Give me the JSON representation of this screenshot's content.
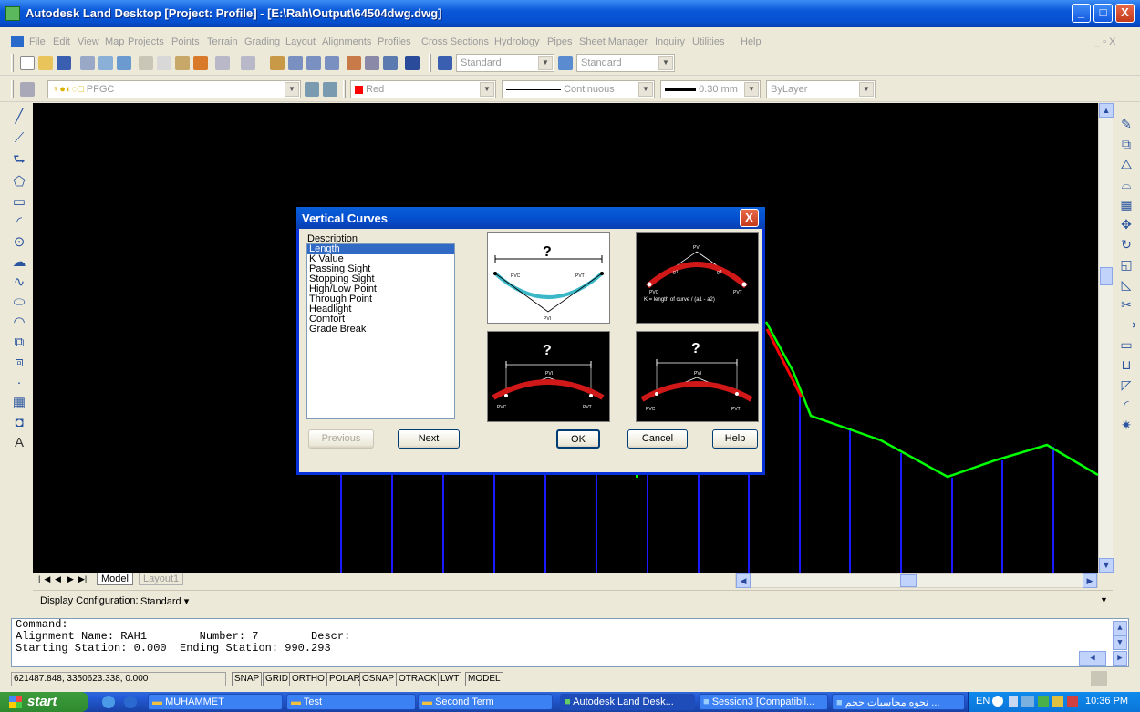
{
  "window": {
    "title": "Autodesk Land Desktop [Project: Profile] - [E:\\Rah\\Output\\64504dwg.dwg]",
    "minimize": "_",
    "maximize": "□",
    "close": "X"
  },
  "menu": {
    "items": [
      "File",
      "Edit",
      "View",
      "Map",
      "Projects",
      "Points",
      "Terrain",
      "Grading",
      "Layout",
      "Alignments",
      "Profiles",
      "Cross Sections",
      "Hydrology",
      "Pipes",
      "Sheet Manager",
      "Inquiry",
      "Utilities",
      "Help"
    ],
    "doc_controls": "_ ▫ X"
  },
  "toolbar1": {
    "text_style": "Standard",
    "dim_style": "Standard"
  },
  "toolbar2": {
    "layer": "PFGC",
    "color": "Red",
    "linetype": "Continuous",
    "lineweight": "0.30 mm",
    "plotstyle": "ByLayer",
    "color_hex": "#ff0000"
  },
  "drawing_tabs": {
    "nav": [
      "|◀",
      "◀",
      "▶",
      "▶|"
    ],
    "model": "Model",
    "layout1": "Layout1"
  },
  "display_configuration": {
    "label": "Display Configuration:",
    "value": "Standard ▾"
  },
  "command": {
    "lines": [
      "Command:",
      "Alignment Name: RAH1        Number: 7        Descr:",
      "Starting Station: 0.000  Ending Station: 990.293"
    ]
  },
  "statusbar": {
    "coords": "621487.848, 3350623.338, 0.000",
    "toggles": [
      "SNAP",
      "GRID",
      "ORTHO",
      "POLAR",
      "OSNAP",
      "OTRACK",
      "LWT",
      "MODEL"
    ]
  },
  "dialog": {
    "title": "Vertical Curves",
    "close": "X",
    "description_label": "Description",
    "items": [
      "Length",
      "K Value",
      "Passing Sight",
      "Stopping Sight",
      "High/Low Point",
      "Through Point",
      "Headlight",
      "Comfort",
      "Grade Break"
    ],
    "selected_index": 0,
    "buttons": {
      "previous": "Previous",
      "next": "Next",
      "ok": "OK",
      "cancel": "Cancel",
      "help": "Help"
    },
    "diagram_question": "?",
    "diagram_formula": "K = length of curve / (a1 - a2)"
  },
  "taskbar": {
    "start": "start",
    "tasks": [
      "MUHAMMET",
      "Test",
      "Second Term",
      "Autodesk Land Desk...",
      "Session3 [Compatibil...",
      "نحوه محاسبات حجم ..."
    ],
    "lang": "EN",
    "clock": "10:36 PM"
  }
}
